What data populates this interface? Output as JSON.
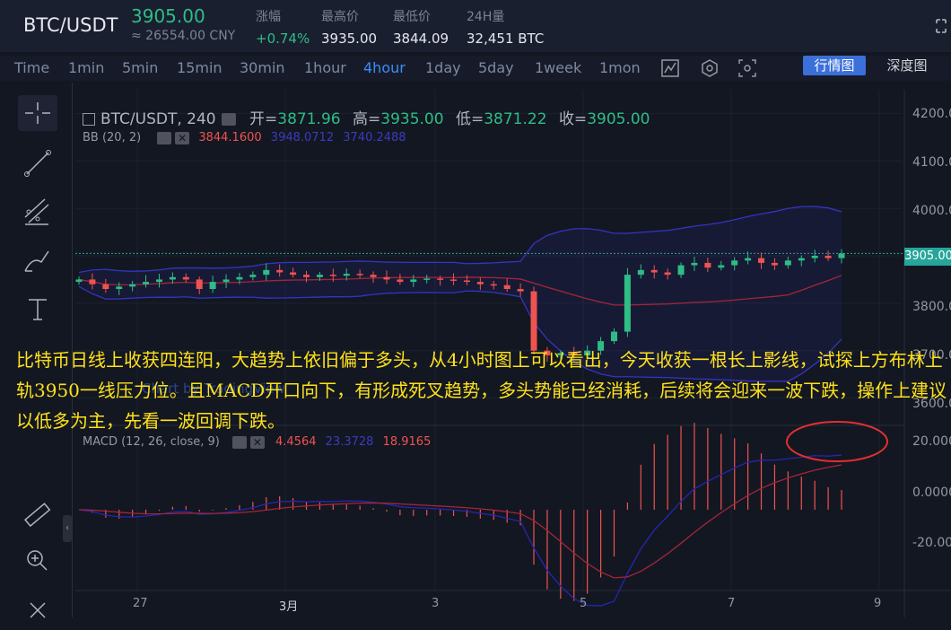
{
  "header": {
    "pair": "BTC/USDT",
    "price": "3905.00",
    "cny": "≈ 26554.00 CNY",
    "stats": [
      {
        "label": "涨幅",
        "value": "+0.74%",
        "up": true
      },
      {
        "label": "最高价",
        "value": "3935.00",
        "up": false
      },
      {
        "label": "最低价",
        "value": "3844.09",
        "up": false
      },
      {
        "label": "24H量",
        "value": "32,451 BTC",
        "up": false
      }
    ]
  },
  "timeframes": {
    "items": [
      "Time",
      "1min",
      "5min",
      "15min",
      "30min",
      "1hour",
      "4hour",
      "1day",
      "5day",
      "1week",
      "1mon"
    ],
    "active": "4hour"
  },
  "view_buttons": {
    "market": "行情图",
    "depth": "深度图"
  },
  "legend": {
    "symbol": "BTC/USDT, 240",
    "open_label": "开=",
    "open": "3871.96",
    "high_label": "高=",
    "high": "3935.00",
    "low_label": "低=",
    "low": "3871.22",
    "close_label": "收=",
    "close": "3905.00"
  },
  "bb": {
    "label": "BB (20, 2)",
    "v1": "3844.1600",
    "v2": "3948.0712",
    "v3": "3740.2488"
  },
  "macd": {
    "label": "MACD (12, 26, close, 9)",
    "v1": "4.4564",
    "v2": "23.3728",
    "v3": "18.9165"
  },
  "price_axis": [
    "4200.00",
    "4100.00",
    "4000.00",
    "3800.00",
    "3700.00",
    "3600.00"
  ],
  "last_price_tag": "3905.00",
  "macd_axis": [
    "20.0000",
    "0.0000",
    "-20.0000"
  ],
  "time_axis": [
    "27",
    "3月",
    "3",
    "5",
    "7",
    "9"
  ],
  "watermark": "Chart by TradingView",
  "annotation": "比特币日线上收获四连阳，大趋势上依旧偏于多头，从4小时图上可以看出，今天收获一根长上影线，试探上方布林上轨3950一线压力位。且MACD开口向下，有形成死叉趋势，多头势能已经消耗，后续将会迎来一波下跌，操作上建议以低多为主，先看一波回调下跌。",
  "colors": {
    "up": "#2ebd85",
    "down": "#ef5350",
    "accent": "#3b8cf7",
    "text_overlay": "#ffe21a"
  },
  "chart_data": {
    "type": "candlestick",
    "interval": "4hour",
    "approx_ohlc_close": [
      3850,
      3840,
      3830,
      3835,
      3840,
      3845,
      3850,
      3855,
      3850,
      3830,
      3845,
      3850,
      3855,
      3860,
      3870,
      3865,
      3860,
      3855,
      3860,
      3858,
      3862,
      3860,
      3855,
      3850,
      3845,
      3850,
      3852,
      3850,
      3848,
      3845,
      3840,
      3838,
      3830,
      3825,
      3700,
      3690,
      3695,
      3690,
      3700,
      3720,
      3740,
      3860,
      3870,
      3865,
      3860,
      3880,
      3885,
      3875,
      3880,
      3890,
      3895,
      3885,
      3880,
      3890,
      3895,
      3900,
      3895,
      3905
    ],
    "price_ylim": [
      3550,
      4250
    ],
    "macd_ylim": [
      -30,
      30
    ]
  },
  "icons": [
    "crosshair-icon",
    "trendline-icon",
    "fib-icon",
    "brush-icon",
    "text-icon",
    "ruler-icon",
    "zoom-icon",
    "indicator-icon",
    "settings-icon",
    "fullscreen-icon"
  ]
}
